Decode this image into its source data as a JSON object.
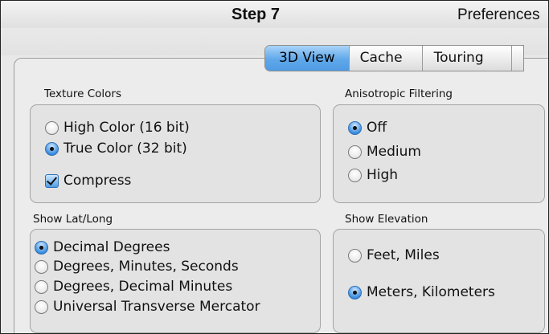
{
  "header": {
    "step": "Step 7",
    "window_title": "Preferences"
  },
  "tabs": [
    {
      "label": "3D View",
      "active": true
    },
    {
      "label": "Cache",
      "active": false
    },
    {
      "label": "Touring",
      "active": false
    }
  ],
  "texture_colors": {
    "label": "Texture Colors",
    "options": [
      {
        "label": "High Color (16 bit)",
        "selected": false
      },
      {
        "label": "True Color (32 bit)",
        "selected": true
      }
    ],
    "compress": {
      "label": "Compress",
      "checked": true
    }
  },
  "anisotropic": {
    "label": "Anisotropic Filtering",
    "options": [
      {
        "label": "Off",
        "selected": true
      },
      {
        "label": "Medium",
        "selected": false
      },
      {
        "label": "High",
        "selected": false
      }
    ]
  },
  "lat_long": {
    "label": "Show Lat/Long",
    "options": [
      {
        "label": "Decimal Degrees",
        "selected": true
      },
      {
        "label": "Degrees, Minutes, Seconds",
        "selected": false
      },
      {
        "label": "Degrees, Decimal Minutes",
        "selected": false
      },
      {
        "label": "Universal Transverse Mercator",
        "selected": false
      }
    ]
  },
  "elevation": {
    "label": "Show Elevation",
    "options": [
      {
        "label": "Feet, Miles",
        "selected": false
      },
      {
        "label": "Meters, Kilometers",
        "selected": true
      }
    ]
  },
  "colors": {
    "accent": "#4f9be3"
  }
}
